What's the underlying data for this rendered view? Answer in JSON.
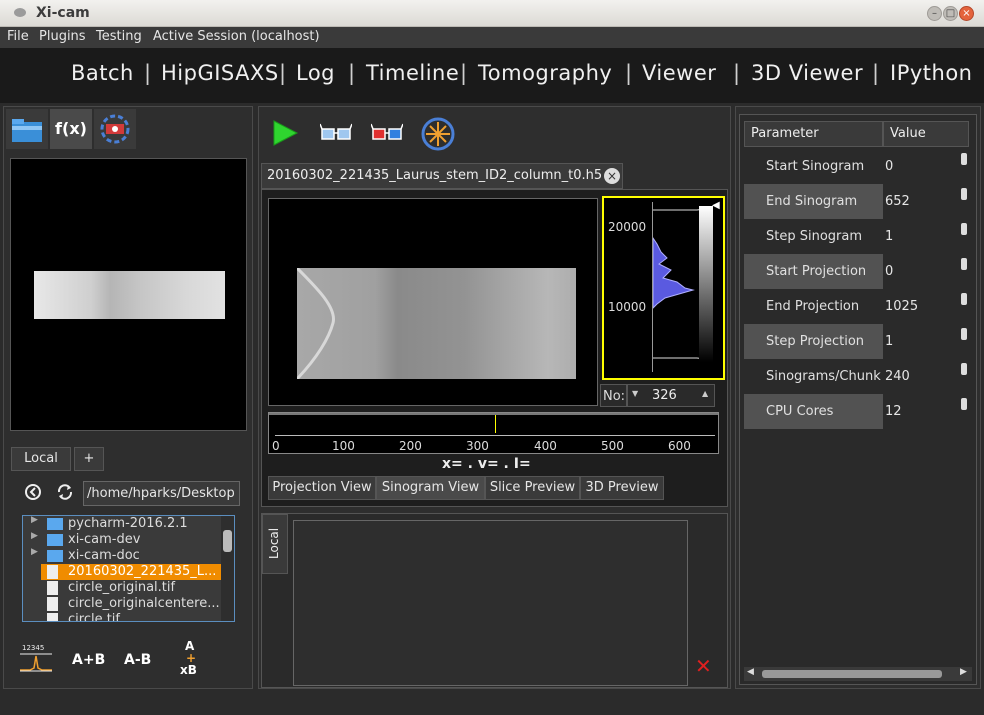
{
  "window": {
    "title": "Xi-cam"
  },
  "menu": [
    "File",
    "Plugins",
    "Testing",
    "Active Session (localhost)"
  ],
  "plugin_tabs": [
    "Batch",
    "HipGISAXS",
    "Log",
    "Timeline",
    "Tomography",
    "Viewer",
    "3D Viewer",
    "IPython"
  ],
  "plugin_sep": "|",
  "left": {
    "fx_label": "f(x)",
    "tabs": [
      "Local",
      "+"
    ],
    "path": "/home/hparks/Desktop",
    "files": [
      {
        "name": "pycharm-2016.2.1",
        "type": "folder"
      },
      {
        "name": "xi-cam-dev",
        "type": "folder"
      },
      {
        "name": "xi-cam-doc",
        "type": "folder"
      },
      {
        "name": "20160302_221435_L...",
        "type": "file",
        "selected": true
      },
      {
        "name": "circle_original.tif",
        "type": "file"
      },
      {
        "name": "circle_originalcentere...",
        "type": "file"
      },
      {
        "name": "circle.tif",
        "type": "file"
      }
    ],
    "tools": [
      "A+B",
      "A-B"
    ],
    "tool_ops": [
      "A",
      "+",
      "xB"
    ],
    "tool_header": "12345"
  },
  "center": {
    "file_tab": "20160302_221435_Laurus_stem_ID2_column_t0.h5",
    "hist_ticks": [
      "20000",
      "10000"
    ],
    "no_label": "No:",
    "no_value": "326",
    "timeline_ticks": [
      "0",
      "100",
      "200",
      "300",
      "400",
      "500",
      "600"
    ],
    "coords": "x= . v= . I=",
    "view_tabs": [
      "Projection View",
      "Sinogram View",
      "Slice Preview",
      "3D Preview"
    ],
    "side_tab": "Local",
    "accent": "#ffff00"
  },
  "right": {
    "header": [
      "Parameter",
      "Value"
    ],
    "params": [
      {
        "name": "Start Sinogram",
        "value": "0"
      },
      {
        "name": "End Sinogram",
        "value": "652"
      },
      {
        "name": "Step Sinogram",
        "value": "1"
      },
      {
        "name": "Start Projection",
        "value": "0"
      },
      {
        "name": "End Projection",
        "value": "1025"
      },
      {
        "name": "Step Projection",
        "value": "1"
      },
      {
        "name": "Sinograms/Chunk",
        "value": "240"
      },
      {
        "name": "CPU Cores",
        "value": "12"
      }
    ]
  }
}
